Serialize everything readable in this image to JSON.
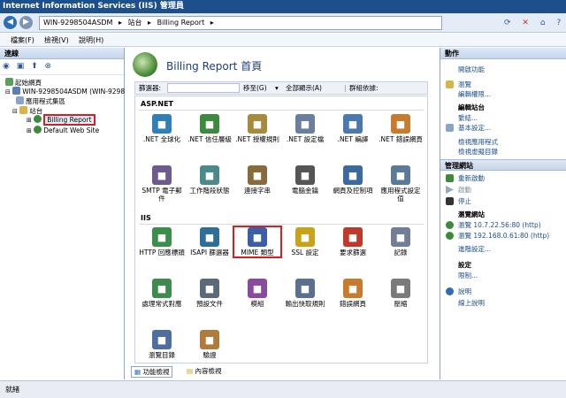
{
  "title_bar": {
    "title": "Internet Information Services (IIS) 管理員"
  },
  "address_bar": {
    "crumbs": [
      "WIN-9298504ASDM",
      "▸",
      "站台",
      "▸",
      "Billing Report",
      "▸"
    ]
  },
  "menu": {
    "file": "檔案(F)",
    "view": "檢視(V)",
    "help": "說明(H)"
  },
  "connections": {
    "title": "連線",
    "tree": [
      "起始網頁",
      "WIN-9298504ASDM (WIN-9298",
      "應用程式集區",
      "站台",
      "Billing Report",
      "Default Web Site"
    ]
  },
  "center": {
    "title": "Billing Report 首頁",
    "filter_label": "篩選器:",
    "go_label": "移至(G)",
    "show_all_label": "全部顯示(A)",
    "group_by_label": "群組依據:",
    "group_aspnet": "ASP.NET",
    "group_iis": "IIS",
    "aspnet_features": [
      {
        "label": ".NET 全球化",
        "icon": "globe-icon",
        "color": "#2f7fb8"
      },
      {
        "label": ".NET 信任層級",
        "icon": "shield-check-icon",
        "color": "#3c8a3c"
      },
      {
        "label": ".NET 授權規則",
        "icon": "lock-doc-icon",
        "color": "#a68b3c"
      },
      {
        "label": ".NET 設定檔",
        "icon": "profile-icon",
        "color": "#6a7fa0"
      },
      {
        "label": ".NET 編譯",
        "icon": "compile-icon",
        "color": "#4a78b0"
      },
      {
        "label": ".NET 錯誤網頁",
        "icon": "error-page-icon",
        "color": "#c97a2a"
      },
      {
        "label": "SMTP 電子郵件",
        "icon": "mail-icon",
        "color": "#6d5a8e"
      },
      {
        "label": "工作階段狀態",
        "icon": "session-icon",
        "color": "#4a8a8a"
      },
      {
        "label": "連接字串",
        "icon": "connection-string-icon",
        "color": "#8a6a3a"
      },
      {
        "label": "電腦金鑰",
        "icon": "key-icon",
        "color": "#555555"
      },
      {
        "label": "網頁及控制項",
        "icon": "pages-icon",
        "color": "#3a6aa0"
      },
      {
        "label": "應用程式設定值",
        "icon": "settings-list-icon",
        "color": "#5a7a9a"
      }
    ],
    "iis_features": [
      {
        "label": "HTTP 回應標頭",
        "icon": "response-header-icon",
        "color": "#3b8f4a"
      },
      {
        "label": "ISAPI 篩選器",
        "icon": "filter-icon",
        "color": "#2d6f9a"
      },
      {
        "label": "MIME 類型",
        "icon": "mime-icon",
        "color": "#3a5fa8",
        "selected": true
      },
      {
        "label": "SSL 設定",
        "icon": "padlock-icon",
        "color": "#c9a21a"
      },
      {
        "label": "要求篩選",
        "icon": "request-filter-icon",
        "color": "#c0392b"
      },
      {
        "label": "記錄",
        "icon": "log-icon",
        "color": "#6f7f95"
      },
      {
        "label": "處理常式對應",
        "icon": "handler-icon",
        "color": "#3f8a4e"
      },
      {
        "label": "預設文件",
        "icon": "default-doc-icon",
        "color": "#5a6a7a"
      },
      {
        "label": "模組",
        "icon": "modules-icon",
        "color": "#8a4aa0"
      },
      {
        "label": "輸出快取規則",
        "icon": "cache-icon",
        "color": "#5b6f8f"
      },
      {
        "label": "錯誤網頁",
        "icon": "error-page-icon",
        "color": "#c97a2a"
      },
      {
        "label": "壓縮",
        "icon": "compress-icon",
        "color": "#7a7a7a"
      },
      {
        "label": "瀏覽目錄",
        "icon": "directory-icon",
        "color": "#4d6fa0"
      },
      {
        "label": "驗證",
        "icon": "user-auth-icon",
        "color": "#b07a3a"
      }
    ],
    "tab_features": "功能檢視",
    "tab_content": "內容檢視"
  },
  "actions": {
    "title": "動作",
    "open_feature": "開啟功能",
    "explore": "瀏覽",
    "edit_permissions": "編輯權限...",
    "edit_site": "編輯站台",
    "bindings": "繫結...",
    "basic_settings": "基本設定...",
    "view_apps": "檢視應用程式",
    "view_vdirs": "檢視虛擬目錄",
    "manage_site": "管理網站",
    "restart": "重新啟動",
    "start": "啟動",
    "stop": "停止",
    "browse_site": "瀏覽網站",
    "browse1": "瀏覽 10.7.22.56:80 (http)",
    "browse2": "瀏覽 192.168.0.61:80 (http)",
    "advanced": "進階設定...",
    "configure": "設定",
    "limits": "限制...",
    "help": "說明",
    "online_help": "線上說明"
  },
  "status_bar": {
    "text": "就緒"
  }
}
